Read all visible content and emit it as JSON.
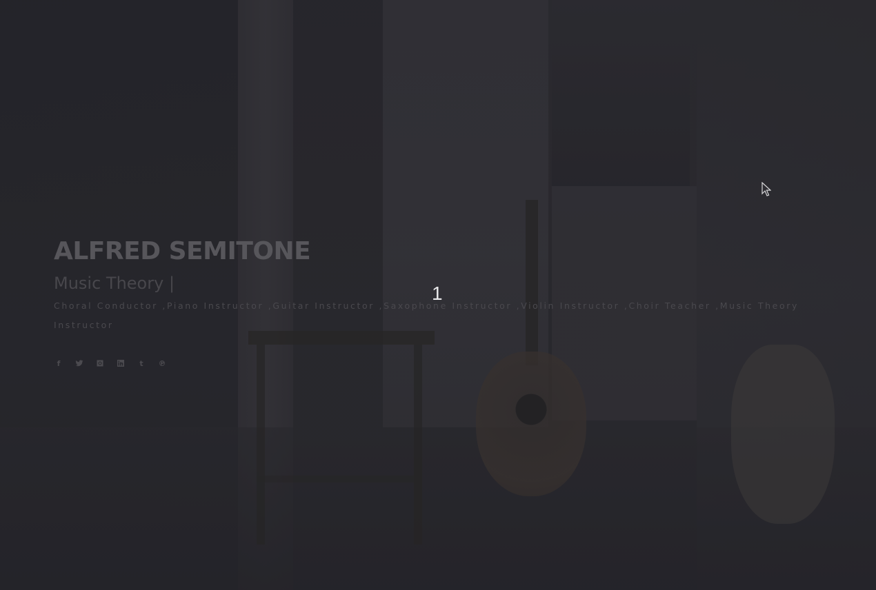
{
  "hero": {
    "name": "ALFRED SEMITONE",
    "typed_role": "Music Theory",
    "typed_cursor": "|",
    "description": "Choral Conductor ,Piano Instructor ,Guitar Instructor ,Saxophone Instructor ,Violin Instructor ,Choir Teacher ,Music Theory Instructor"
  },
  "socials": [
    {
      "icon": "facebook-icon",
      "glyph": "f"
    },
    {
      "icon": "twitter-icon",
      "glyph": ""
    },
    {
      "icon": "instagram-icon",
      "glyph": ""
    },
    {
      "icon": "linkedin-icon",
      "glyph": ""
    },
    {
      "icon": "tumblr-icon",
      "glyph": "t"
    },
    {
      "icon": "pinterest-icon",
      "glyph": "℗"
    }
  ],
  "loader": {
    "count": "1"
  },
  "colors": {
    "overlay": "#2f2e33",
    "loader_text": "#e8e8ea",
    "hero_text": "#57565b"
  }
}
